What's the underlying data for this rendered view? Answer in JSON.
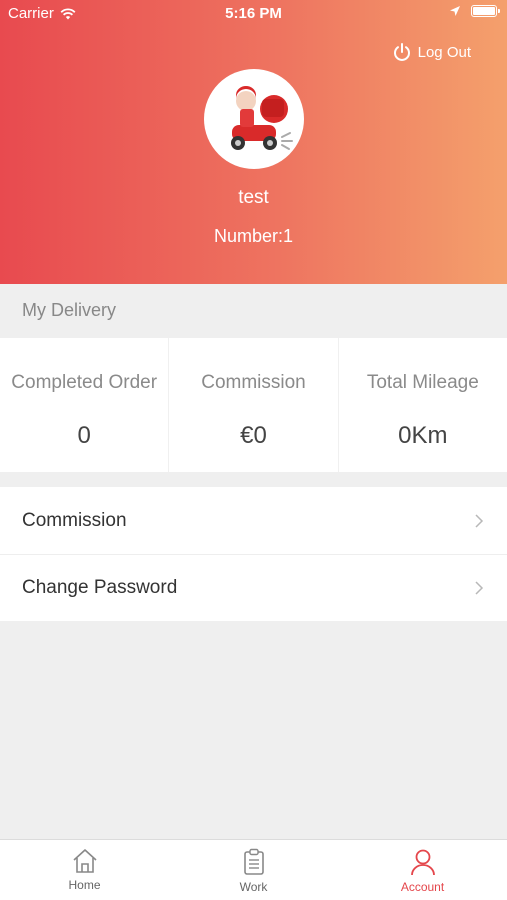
{
  "status_bar": {
    "carrier": "Carrier",
    "time": "5:16 PM"
  },
  "header": {
    "logout_label": "Log Out",
    "username": "test",
    "number": "Number:1",
    "gradient_colors": [
      "#e84a4f",
      "#f4a06c"
    ]
  },
  "delivery": {
    "section_title": "My Delivery",
    "stats": [
      {
        "label": "Completed Order",
        "value": "0"
      },
      {
        "label": "Commission",
        "value": "€0"
      },
      {
        "label": "Total Mileage",
        "value": "0Km"
      }
    ]
  },
  "menu": {
    "items": [
      {
        "label": "Commission",
        "icon": "chevron-right-icon"
      },
      {
        "label": "Change Password",
        "icon": "chevron-right-icon"
      }
    ]
  },
  "tabbar": {
    "items": [
      {
        "label": "Home",
        "icon": "home-icon"
      },
      {
        "label": "Work",
        "icon": "clipboard-icon"
      },
      {
        "label": "Account",
        "icon": "user-icon",
        "active": true
      }
    ],
    "active_color": "#e4464b"
  }
}
